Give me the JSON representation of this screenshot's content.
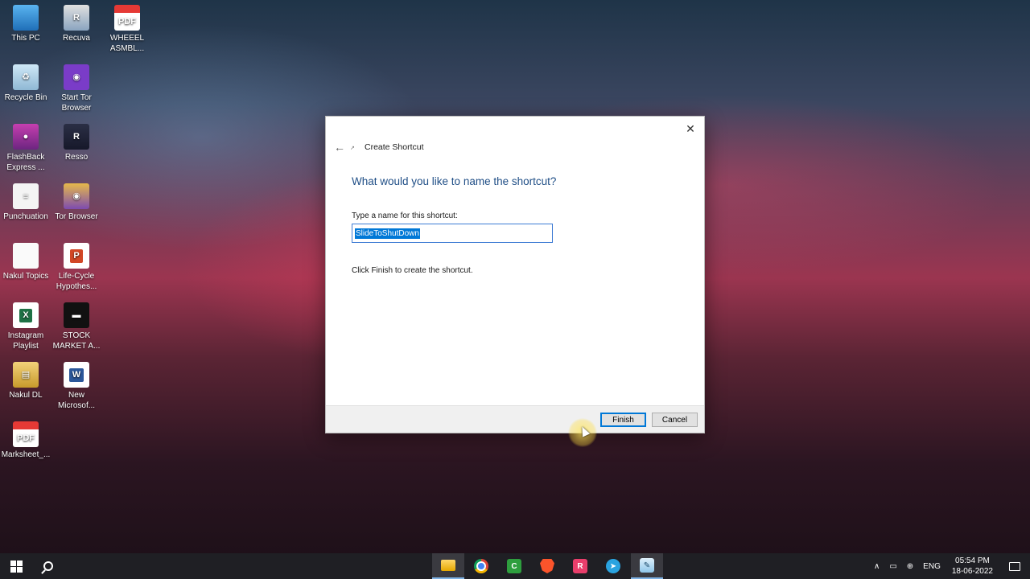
{
  "desktop": {
    "icons": [
      {
        "label": "This PC",
        "glyph": "pc-icon",
        "text": ""
      },
      {
        "label": "Recuva",
        "glyph": "recuva-icon",
        "text": "R"
      },
      {
        "label": "WHEEEL ASMBL...",
        "glyph": "pdf-icon",
        "text": "PDF"
      },
      {
        "label": "Recycle Bin",
        "glyph": "recycle-bin-icon",
        "text": "♻"
      },
      {
        "label": "Start Tor Browser",
        "glyph": "tor-icon",
        "text": "◉"
      },
      {
        "label": "FlashBack Express ...",
        "glyph": "flashback-icon",
        "text": "●"
      },
      {
        "label": "Resso",
        "glyph": "resso-icon",
        "text": "R"
      },
      {
        "label": "Punchuation",
        "glyph": "punch-icon",
        "text": "≡"
      },
      {
        "label": "Tor Browser",
        "glyph": "tor-browser-icon",
        "text": "◉"
      },
      {
        "label": "Nakul Topics",
        "glyph": "document-icon",
        "text": ""
      },
      {
        "label": "Life-Cycle Hypothes...",
        "glyph": "powerpoint-icon",
        "text": "P"
      },
      {
        "label": "Instagram Playlist",
        "glyph": "excel-icon",
        "text": "X"
      },
      {
        "label": "STOCK MARKET A...",
        "glyph": "video-thumb-icon",
        "text": "▬"
      },
      {
        "label": "Nakul DL",
        "glyph": "zip-icon",
        "text": "▤"
      },
      {
        "label": "New Microsof...",
        "glyph": "word-icon",
        "text": "W"
      },
      {
        "label": "Marksheet_...",
        "glyph": "pdf-icon",
        "text": "PDF"
      }
    ]
  },
  "dialog": {
    "wizard_title": "Create Shortcut",
    "heading": "What would you like to name the shortcut?",
    "field_label": "Type a name for this shortcut:",
    "name_value": "SlideToShutDown",
    "hint": "Click Finish to create the shortcut.",
    "finish_label": "Finish",
    "cancel_label": "Cancel",
    "close_glyph": "✕",
    "back_glyph": "←"
  },
  "taskbar": {
    "language": "ENG",
    "time": "05:54 PM",
    "date": "18-06-2022"
  }
}
